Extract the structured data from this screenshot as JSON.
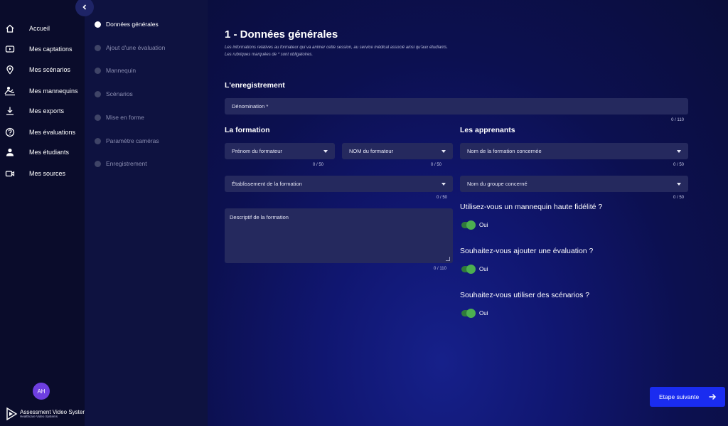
{
  "sidebar": {
    "items": [
      {
        "label": "Accueil",
        "icon": "home-icon"
      },
      {
        "label": "Mes captations",
        "icon": "video-play-icon"
      },
      {
        "label": "Mes scénarios",
        "icon": "map-pin-icon"
      },
      {
        "label": "Mes mannequins",
        "icon": "mannequin-icon"
      },
      {
        "label": "Mes exports",
        "icon": "download-icon"
      },
      {
        "label": "Mes évaluations",
        "icon": "help-circle-icon"
      },
      {
        "label": "Mes étudiants",
        "icon": "user-icon"
      },
      {
        "label": "Mes sources",
        "icon": "camera-icon"
      }
    ],
    "avatar_initials": "AH",
    "brand_title": "Assessment Video System",
    "brand_subtitle": "Healthcare Video Systems"
  },
  "steps": [
    {
      "label": "Données générales",
      "active": true
    },
    {
      "label": "Ajout d'une évaluation",
      "active": false
    },
    {
      "label": "Mannequin",
      "active": false
    },
    {
      "label": "Scénarios",
      "active": false
    },
    {
      "label": "Mise en forme",
      "active": false
    },
    {
      "label": "Paramètre caméras",
      "active": false
    },
    {
      "label": "Enregistrement",
      "active": false
    }
  ],
  "main": {
    "title": "1 - Données générales",
    "desc_line1": "Les informations relatives au formateur qui va animer cette session, au service médical associé ainsi qu'aux étudiants.",
    "desc_line2": "Les rubriques marquées de * sont obligatoires.",
    "section_enregistrement": "L'enregistrement",
    "denomination": {
      "placeholder": "Dénomination *",
      "counter": "0 / 110"
    },
    "section_formation": "La formation",
    "prenom_formateur": {
      "placeholder": "Prénom du formateur",
      "counter": "0 / 50"
    },
    "nom_formateur": {
      "placeholder": "NOM du formateur",
      "counter": "0 / 50"
    },
    "etablissement": {
      "placeholder": "Établissement de la formation",
      "counter": "0 / 50"
    },
    "descriptif": {
      "placeholder": "Descriptif de la formation",
      "counter": "0 / 110"
    },
    "section_apprenants": "Les apprenants",
    "nom_formation": {
      "placeholder": "Nom de la formation concernée",
      "counter": "0 / 50"
    },
    "nom_groupe": {
      "placeholder": "Nom du groupe concerné",
      "counter": "0 / 50"
    },
    "questions": [
      {
        "label": "Utilisez-vous un mannequin haute fidélité ?",
        "toggle_label": "Oui",
        "value": true
      },
      {
        "label": "Souhaitez-vous ajouter une évaluation ?",
        "toggle_label": "Oui",
        "value": true
      },
      {
        "label": "Souhaitez-vous utiliser des scénarios ?",
        "toggle_label": "Oui",
        "value": true
      }
    ],
    "next_button": "Etape suivante"
  },
  "colors": {
    "accent": "#1a2cf0",
    "toggle_on": "#4caf50",
    "avatar": "#6e3fe0",
    "field_bg": "#25295e"
  }
}
